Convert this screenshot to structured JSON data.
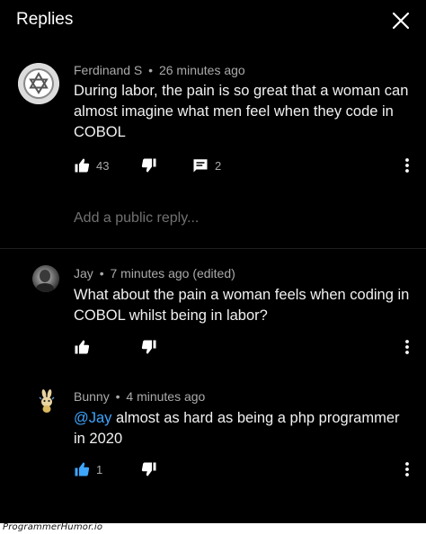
{
  "header": {
    "title": "Replies",
    "close_icon": "close-icon"
  },
  "comments": [
    {
      "author": "Ferdinand S",
      "separator": "•",
      "time": "26 minutes ago",
      "text": "During labor, the pain is so great that a woman can almost imagine what men feel when they code in COBOL",
      "likes": "43",
      "replies": "2",
      "avatar_icon": "star-of-david-icon"
    },
    {
      "author": "Jay",
      "separator": "•",
      "time": "7 minutes ago (edited)",
      "text": "What about the pain a woman feels when coding in COBOL whilst being in labor?",
      "likes": "",
      "avatar_icon": "profile-photo"
    },
    {
      "author": "Bunny",
      "separator": "•",
      "time": "4 minutes ago",
      "mention": "@Jay",
      "text": " almost as hard as being a php programmer in 2020",
      "likes": "1",
      "like_active": true,
      "avatar_icon": "bunny-avatar"
    }
  ],
  "reply_input": {
    "placeholder": "Add a public reply..."
  },
  "footer": {
    "watermark": "ProgrammerHumor.io"
  },
  "colors": {
    "background": "#000000",
    "mention": "#3ea6ff",
    "active_like": "#3ea6ff",
    "meta": "#aaaaaa"
  }
}
